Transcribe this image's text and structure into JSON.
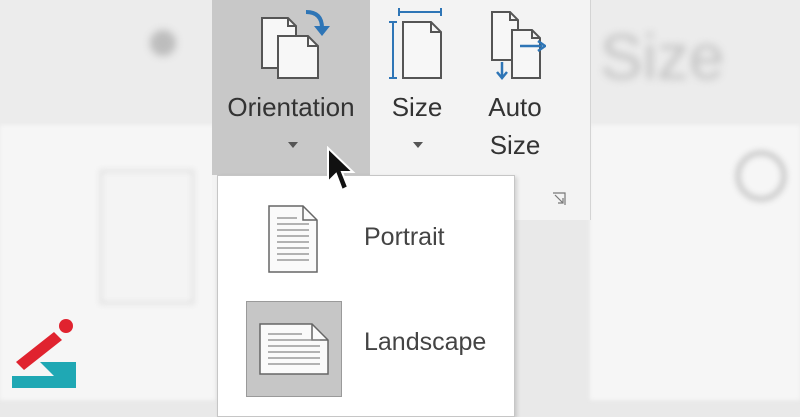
{
  "ribbon": {
    "orientation": {
      "label": "Orientation",
      "icon": "orientation-icon"
    },
    "size": {
      "label": "Size",
      "icon": "size-icon"
    },
    "auto_size": {
      "line1": "Auto",
      "line2": "Size",
      "icon": "auto-size-icon"
    }
  },
  "orientation_menu": {
    "items": [
      {
        "label": "Portrait",
        "icon": "portrait-page-icon",
        "selected": false
      },
      {
        "label": "Landscape",
        "icon": "landscape-page-icon",
        "selected": true
      }
    ]
  },
  "background": {
    "blurred_text": "Size"
  },
  "colors": {
    "selected_bg": "#c8c8c8",
    "accent_blue": "#2e75b6",
    "logo_red": "#e0232f",
    "logo_teal": "#1fa8b4"
  }
}
